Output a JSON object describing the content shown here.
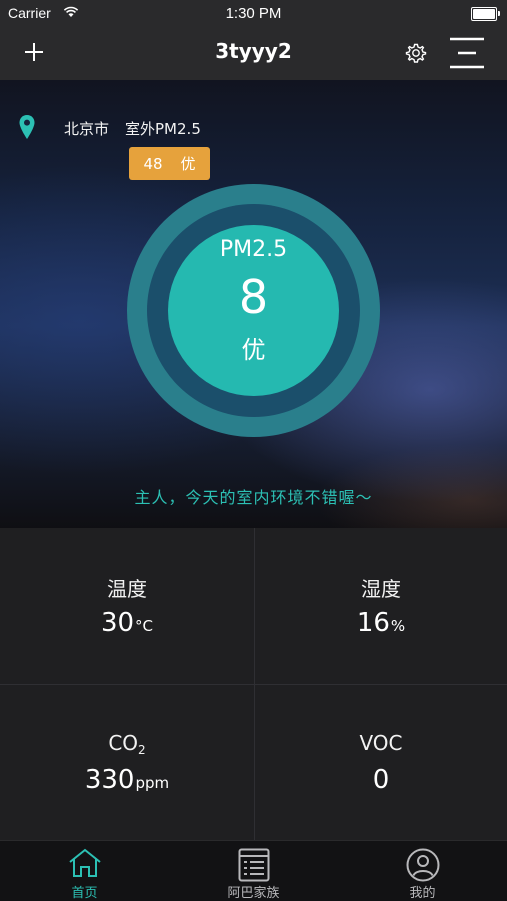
{
  "status_bar": {
    "carrier": "Carrier",
    "time": "1:30 PM"
  },
  "nav": {
    "title": "3tyyy2"
  },
  "location": {
    "city": "北京市",
    "outdoor_label": "室外PM2.5"
  },
  "outdoor_badge": {
    "value": "48",
    "level": "优"
  },
  "indoor": {
    "label": "PM2.5",
    "value": "8",
    "level": "优"
  },
  "message": "主人，今天的室内环境不错喔～",
  "stats": {
    "temperature": {
      "label": "温度",
      "value": "30",
      "unit": "°C"
    },
    "humidity": {
      "label": "湿度",
      "value": "16",
      "unit": "%"
    },
    "co2": {
      "label_main": "CO",
      "label_sub": "2",
      "value": "330",
      "unit": "ppm"
    },
    "voc": {
      "label": "VOC",
      "value": "0"
    }
  },
  "tabs": [
    {
      "label": "首页",
      "icon": "home-icon",
      "active": true
    },
    {
      "label": "阿巴家族",
      "icon": "list-icon",
      "active": false
    },
    {
      "label": "我的",
      "icon": "user-icon",
      "active": false
    }
  ],
  "colors": {
    "accent": "#2cc0b4",
    "badge": "#e6a23c",
    "ring_inner": "#25b9b0"
  }
}
